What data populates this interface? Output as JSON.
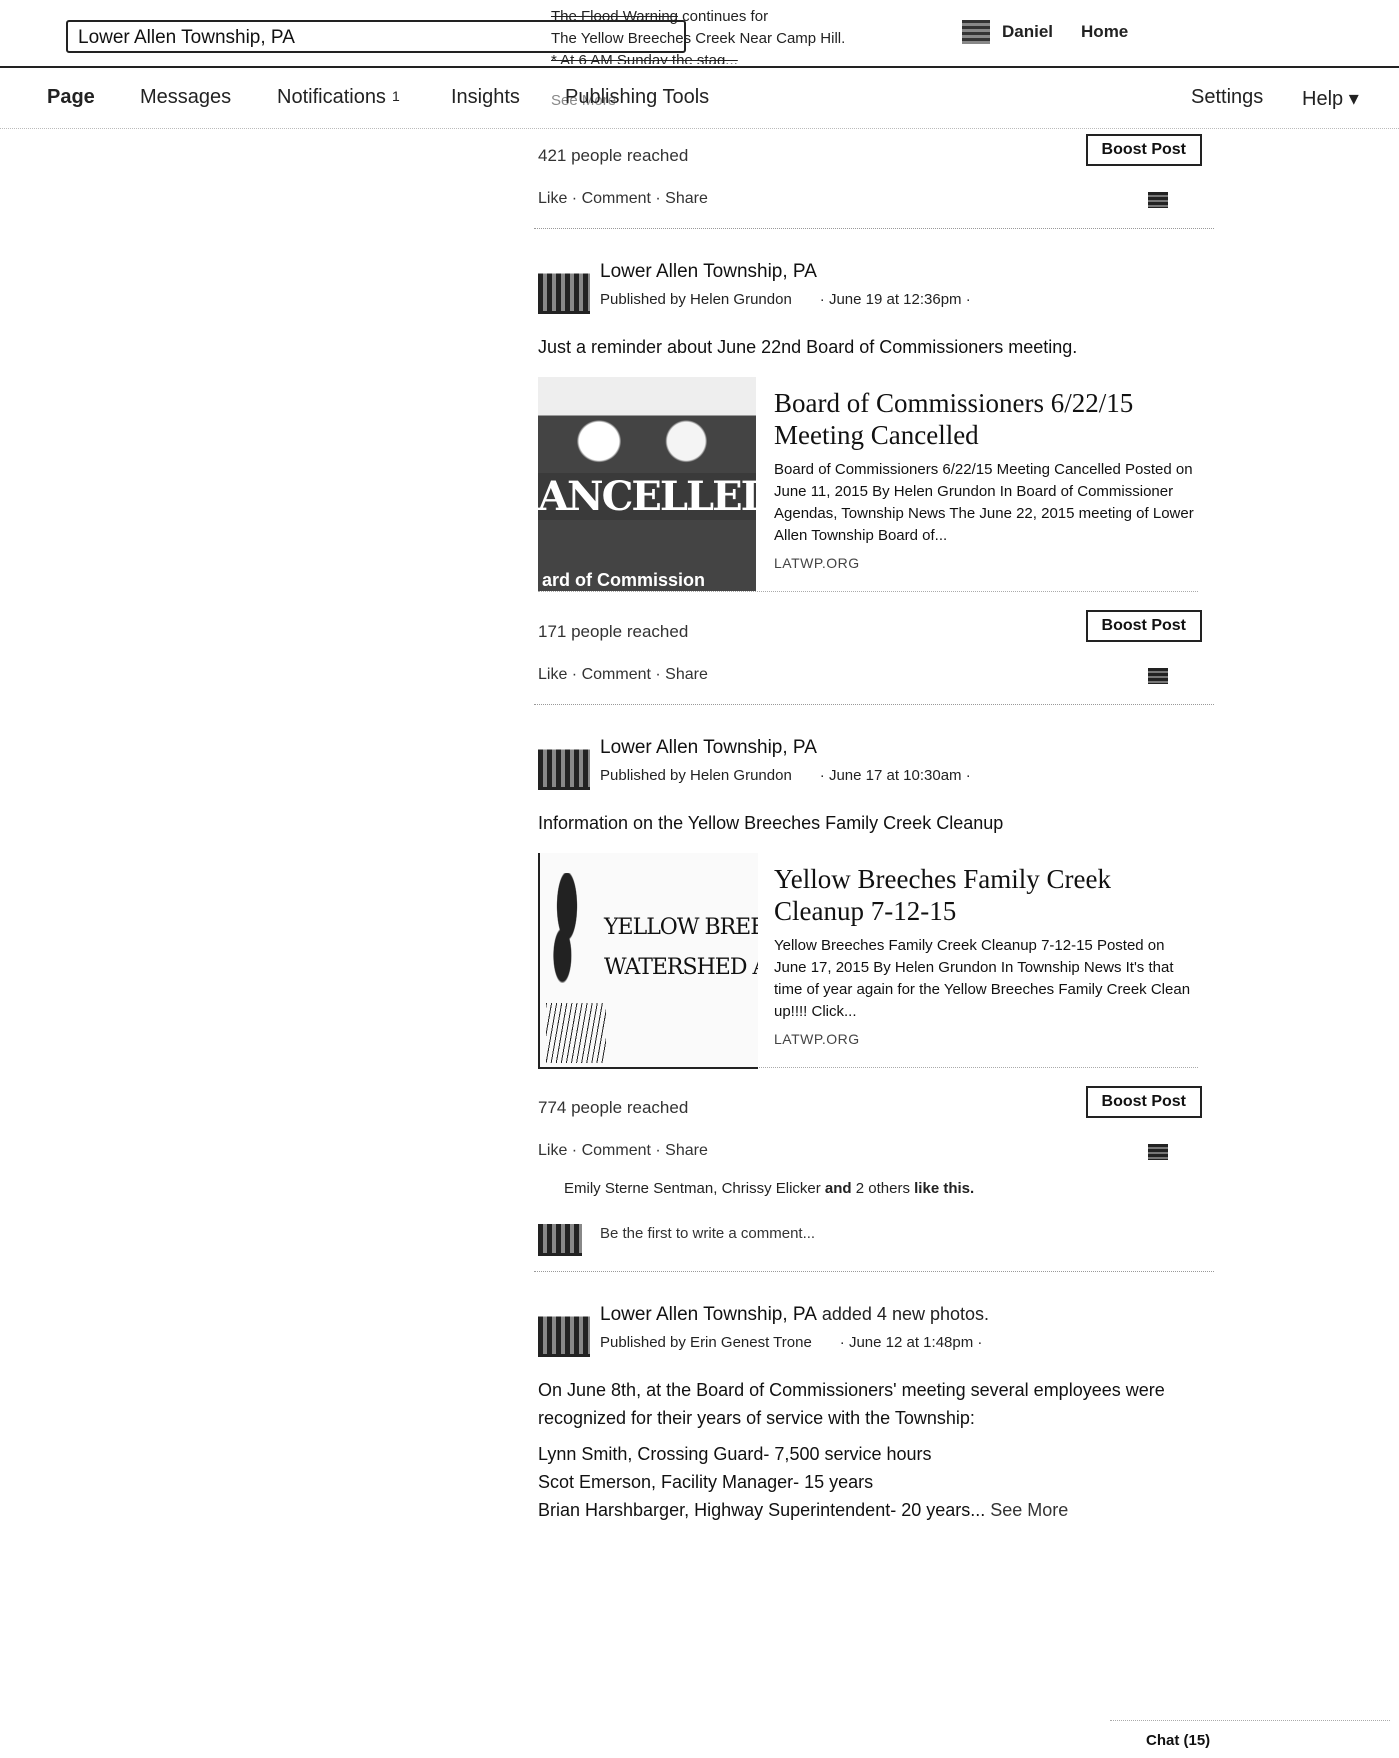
{
  "topbar": {
    "search_value": "Lower Allen Township, PA",
    "flood_line1_strike": "The Flood Warning",
    "flood_line1_rest": " continues for",
    "flood_line2": "The Yellow Breeches Creek Near Camp Hill.",
    "flood_line3": "* At 6 AM Sunday the stag...",
    "user_name": "Daniel",
    "home_label": "Home"
  },
  "nav": {
    "page": "Page",
    "messages": "Messages",
    "notifications": "Notifications",
    "notifications_count": "1",
    "insights": "Insights",
    "publishing_tools": "Publishing Tools",
    "see_more_ghost": "See More",
    "settings": "Settings",
    "help": "Help ▾"
  },
  "post0": {
    "reached": "421 people reached",
    "boost": "Boost Post",
    "like": "Like",
    "comment": "Comment",
    "share": "Share",
    "sep": " · "
  },
  "post1": {
    "author": "Lower Allen Township, PA",
    "published_by": "Published by Helen Grundon",
    "when": "· June 19 at 12:36pm ·",
    "text": "Just a reminder about June 22nd Board of Commissioners meeting.",
    "img_banner": "ANCELLED",
    "img_caption": "ard of Commission",
    "link_title": "Board of Commissioners 6/22/15 Meeting Cancelled",
    "link_desc": "Board of Commissioners 6/22/15 Meeting Cancelled Posted on June 11, 2015 By Helen Grundon In Board of Commissioner Agendas, Township News The June 22, 2015 meeting of Lower Allen Township Board of...",
    "link_domain": "LATWP.ORG",
    "reached": "171 people reached",
    "boost": "Boost Post",
    "like": "Like",
    "comment": "Comment",
    "share": "Share",
    "sep": " · "
  },
  "post2": {
    "author": "Lower Allen Township, PA",
    "published_by": "Published by Helen Grundon",
    "when": "· June 17 at 10:30am ·",
    "text": "Information on the Yellow Breeches Family Creek Cleanup",
    "img_line1": "YELLOW BREECHE",
    "img_line2": "WATERSHED ASSO",
    "link_title": "Yellow Breeches Family Creek Cleanup 7-12-15",
    "link_desc": "Yellow Breeches Family Creek Cleanup 7-12-15 Posted on June 17, 2015 By Helen Grundon In Township News It's that time of year again for the Yellow Breeches Family Creek Clean up!!!! Click...",
    "link_domain": "LATWP.ORG",
    "reached": "774 people reached",
    "boost": "Boost Post",
    "like": "Like",
    "comment": "Comment",
    "share": "Share",
    "sep": " · ",
    "likers": "Emily Sterne Sentman, Chrissy Elicker",
    "likers_and": " and ",
    "likers_others": "2 others",
    "likers_suffix": " like this.",
    "comment_placeholder": "Be the first to write a comment..."
  },
  "post3": {
    "author": "Lower Allen Township, PA",
    "added": " added 4 new photos.",
    "published_by": "Published by Erin Genest Trone",
    "when": "· June 12 at 1:48pm ·",
    "text": "On June 8th, at the Board of Commissioners' meeting several employees were recognized for their years of service with the Township:",
    "line1": "Lynn Smith, Crossing Guard- 7,500 service hours",
    "line2": "Scot Emerson, Facility Manager- 15 years",
    "line3": "Brian Harshbarger, Highway Superintendent- 20 years...",
    "see_more": " See More"
  },
  "chat": {
    "label": "Chat (15)"
  }
}
